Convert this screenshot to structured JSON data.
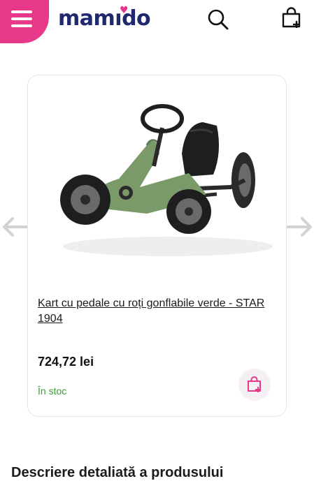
{
  "header": {
    "logo_prefix": "mam",
    "logo_suffix": "do",
    "brand_color": "#20286e",
    "accent_color": "#e8388a",
    "icons": [
      "menu-icon",
      "search-icon",
      "cart-plus-icon"
    ]
  },
  "product": {
    "title": "Kart cu pedale cu roți gonflabile verde - STAR 1904",
    "price": "724,72 lei",
    "stock": "În stoc",
    "stock_color": "#3a9a3a",
    "image_icon": "go-kart-image"
  },
  "carousel": {
    "prev_icon": "arrow-left-icon",
    "next_icon": "arrow-right-icon"
  },
  "section": {
    "title": "Descriere detaliată a produsului"
  }
}
